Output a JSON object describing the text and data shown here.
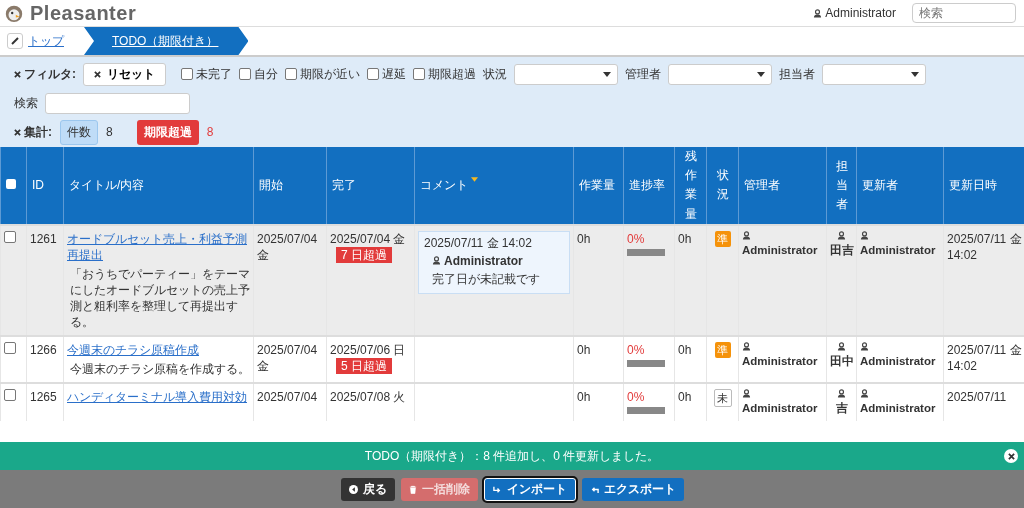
{
  "header": {
    "brand": "Pleasanter",
    "user": "Administrator",
    "search": {
      "placeholder": "検索"
    }
  },
  "breadcrumb": [
    {
      "label": "トップ",
      "current": false
    },
    {
      "label": "TODO（期限付き）",
      "current": true
    }
  ],
  "filter": {
    "label": "フィルタ:",
    "reset": "リセット",
    "checkboxes": [
      {
        "label": "未完了",
        "checked": false
      },
      {
        "label": "自分",
        "checked": false
      },
      {
        "label": "期限が近い",
        "checked": false
      },
      {
        "label": "遅延",
        "checked": false
      },
      {
        "label": "期限超過",
        "checked": false
      }
    ],
    "selects": [
      {
        "label": "状況"
      },
      {
        "label": "管理者"
      },
      {
        "label": "担当者"
      }
    ],
    "search_label": "検索"
  },
  "aggregate": {
    "label": "集計:",
    "items": [
      {
        "label": "件数",
        "count": "8",
        "kind": "total"
      },
      {
        "label": "期限超過",
        "count": "8",
        "kind": "overdue"
      }
    ]
  },
  "table": {
    "select_all_checked": false,
    "columns": [
      {
        "label": "ID",
        "sorted": false
      },
      {
        "label": "タイトル/内容",
        "sorted": false
      },
      {
        "label": "開始",
        "sorted": false
      },
      {
        "label": "完了",
        "sorted": false
      },
      {
        "label": "コメント",
        "sorted": true
      },
      {
        "label": "作業量",
        "sorted": false
      },
      {
        "label": "進捗率",
        "sorted": false
      },
      {
        "label": "残作業量",
        "sorted": false
      },
      {
        "label": "状況",
        "sorted": false
      },
      {
        "label": "管理者",
        "sorted": false
      },
      {
        "label": "担当者",
        "sorted": false
      },
      {
        "label": "更新者",
        "sorted": false
      },
      {
        "label": "更新日時",
        "sorted": false
      }
    ],
    "rows": [
      {
        "checked": false,
        "highlighted": true,
        "id": "1261",
        "title": "オードブルセット売上・利益予測再提出",
        "body": "「おうちでパーティー」をテーマにしたオードブルセットの売上予測と粗利率を整理して再提出する。",
        "start": "2025/07/04 金",
        "end": "2025/07/04 金",
        "overdue": {
          "label": "7 日超過",
          "kind": "strong"
        },
        "comment": {
          "time": "2025/07/11 金 14:02",
          "user": "Administrator",
          "text": "完了日が未記載です"
        },
        "work": "0h",
        "progress": "0%",
        "level": 0,
        "remaining": "0h",
        "status": {
          "label": "準",
          "kind": "preparing"
        },
        "manager": "Administrator",
        "owner": "田吉",
        "updater": "Administrator",
        "updated": "2025/07/11 金 14:02"
      },
      {
        "checked": false,
        "highlighted": false,
        "id": "1266",
        "title": "今週末のチラシ原稿作成",
        "body": "今週末のチラシ原稿を作成する。",
        "start": "2025/07/04 金",
        "end": "2025/07/06 日",
        "overdue": {
          "label": "5 日超過",
          "kind": "strong"
        },
        "work": "0h",
        "progress": "0%",
        "level": 0,
        "remaining": "0h",
        "status": {
          "label": "準",
          "kind": "preparing"
        },
        "manager": "Administrator",
        "owner": "田中",
        "updater": "Administrator",
        "updated": "2025/07/11 金 14:02"
      },
      {
        "checked": false,
        "highlighted": false,
        "id": "1265",
        "title": "ハンディターミナル導入費用対効",
        "start": "2025/07/04",
        "end": "2025/07/08 火",
        "work": "0h",
        "progress": "0%",
        "level": 0,
        "remaining": "0h",
        "status": {
          "label": "未",
          "kind": "not_started"
        },
        "manager": "Administrator",
        "owner": "吉",
        "updater": "Administrator",
        "updated": "2025/07/11"
      }
    ]
  },
  "message": "TODO（期限付き）：8 件追加し、0 件更新しました。",
  "footer_buttons": [
    {
      "label": "戻る",
      "kind": "back",
      "disabled": false
    },
    {
      "label": "一括削除",
      "kind": "delete",
      "disabled": true
    },
    {
      "label": "インポート",
      "kind": "import",
      "disabled": false
    },
    {
      "label": "エクスポート",
      "kind": "export",
      "disabled": false
    }
  ]
}
